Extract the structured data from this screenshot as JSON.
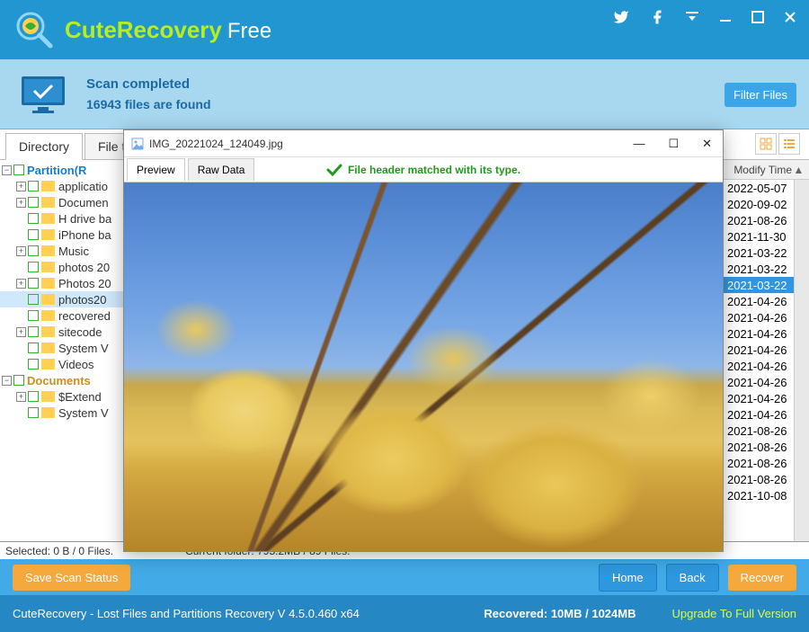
{
  "titlebar": {
    "app_name": "CuteRecovery",
    "app_suffix": "Free"
  },
  "status": {
    "title": "Scan completed",
    "subtitle": "16943 files are found",
    "filter_btn": "Filter Files"
  },
  "tabs": {
    "directory": "Directory",
    "file_type": "File t"
  },
  "tree": {
    "root1": "Partition(R",
    "items": [
      "applicatio",
      "Documen",
      "H drive ba",
      "iPhone ba",
      "Music",
      "photos 20",
      "Photos 20",
      "photos20",
      "recovered",
      "sitecode",
      "System V",
      "Videos"
    ],
    "root2": "Documents",
    "items2": [
      "$Extend",
      "System V"
    ]
  },
  "list": {
    "header_modify": "Modify Time",
    "dates": [
      "2022-05-07",
      "2020-09-02",
      "2021-08-26",
      "2021-11-30",
      "2021-03-22",
      "2021-03-22",
      "2021-03-22",
      "2021-04-26",
      "2021-04-26",
      "2021-04-26",
      "2021-04-26",
      "2021-04-26",
      "2021-04-26",
      "2021-04-26",
      "2021-04-26",
      "2021-08-26",
      "2021-08-26",
      "2021-08-26",
      "2021-08-26",
      "2021-10-08"
    ],
    "selected_index": 6
  },
  "info": {
    "selected": "Selected: 0 B / 0 Files.",
    "current": "Current folder: 795.2MB / 89 Files."
  },
  "footer": {
    "save": "Save Scan Status",
    "home": "Home",
    "back": "Back",
    "recover": "Recover"
  },
  "bottom": {
    "product": "CuteRecovery - Lost Files and Partitions Recovery  V 4.5.0.460 x64",
    "recovered": "Recovered: 10MB / 1024MB",
    "upgrade": "Upgrade To Full Version"
  },
  "preview": {
    "filename": "IMG_20221024_124049.jpg",
    "tab_preview": "Preview",
    "tab_raw": "Raw Data",
    "message": "File header matched with its type."
  }
}
